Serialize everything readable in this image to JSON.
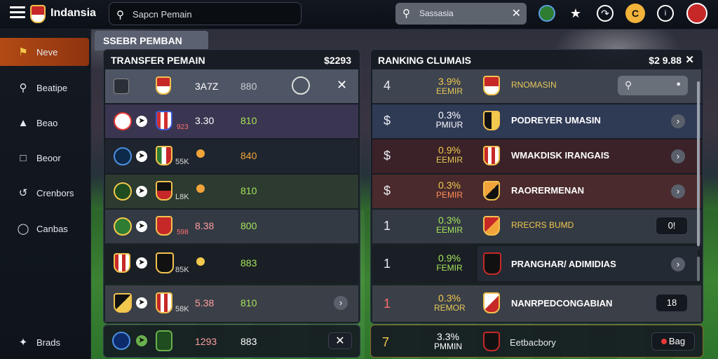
{
  "app": {
    "title": "Indansia"
  },
  "search_main": {
    "text": "Sapcn Pemain"
  },
  "search_alt": {
    "text": "Sassasia"
  },
  "sidebar": {
    "items": [
      {
        "label": "Neve",
        "icon": "home-icon",
        "active": true
      },
      {
        "label": "Beatipe",
        "icon": "search-icon",
        "active": false
      },
      {
        "label": "Beao",
        "icon": "building-icon",
        "active": false
      },
      {
        "label": "Beoor",
        "icon": "square-icon",
        "active": false
      },
      {
        "label": "Crenbors",
        "icon": "chart-icon",
        "active": false
      },
      {
        "label": "Canbas",
        "icon": "clock-icon",
        "active": false
      },
      {
        "label": "Brads",
        "icon": "star-icon",
        "active": false
      }
    ]
  },
  "section_tab": {
    "label": "SSEBR PEMBAN"
  },
  "transfer": {
    "title": "TRANSFER PEMAIN",
    "amount": "$2293",
    "header_row": {
      "name": "3A7Z",
      "value": "880"
    },
    "rows": [
      {
        "badge": "923",
        "name": "3.30",
        "value": "810",
        "value_color": "#a6e35a"
      },
      {
        "badge": "",
        "name": "55K",
        "value": "840",
        "value_color": "#f2a43a"
      },
      {
        "badge": "",
        "name": "L8K",
        "value": "810",
        "value_color": "#a6e35a"
      },
      {
        "badge": "598",
        "name": "8.38",
        "value": "800",
        "value_color": "#a6e35a"
      },
      {
        "badge": "",
        "name": "85K",
        "value": "883",
        "value_color": "#a6e35a"
      },
      {
        "badge": "",
        "name": "58K",
        "value": "5.38",
        "value2": "810",
        "value_color": "#a6e35a"
      },
      {
        "badge": "",
        "name": "",
        "value": "1293",
        "value2": "883",
        "value_color": "#ffffff"
      }
    ]
  },
  "ranking": {
    "title": "RANKING CLUMAIS",
    "amount": "$2 9.88",
    "rows": [
      {
        "rank": "4",
        "pct": "3.9%",
        "sub": "EEMIR",
        "club": "RNOMASIN"
      },
      {
        "rank": "$",
        "pct": "0.3%",
        "sub": "PMIUR",
        "club": "PODREYER UMASIN"
      },
      {
        "rank": "$",
        "pct": "0.9%",
        "sub": "EEMIR",
        "club": "WMAKDISK IRANGAIS"
      },
      {
        "rank": "$",
        "pct": "0.3%",
        "sub": "PEMIR",
        "club": "RAORERMENAN"
      },
      {
        "rank": "1",
        "pct": "0.3%",
        "sub": "EEMIR",
        "club": "RRECRS BUMD",
        "pill": "0!"
      },
      {
        "rank": "1",
        "pct": "0.9%",
        "sub": "FEMIR",
        "club": "PRANGHAR/ ADIMIDIAS"
      },
      {
        "rank": "1",
        "pct": "0.3%",
        "sub": "REMOR",
        "club": "NANRPEDCONGABIAN",
        "pill": "18"
      },
      {
        "rank": "7",
        "pct": "3.3%",
        "sub": "PMMIN",
        "club": "Eetbacbory",
        "pill": "Bag"
      }
    ]
  }
}
